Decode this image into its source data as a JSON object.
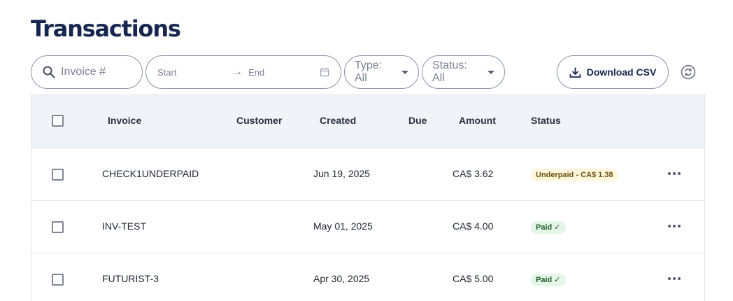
{
  "header": {
    "title": "Transactions"
  },
  "toolbar": {
    "search_placeholder": "Invoice #",
    "date_start_placeholder": "Start",
    "date_arrow": "→",
    "date_end_placeholder": "End",
    "type_filter_label": "Type: All",
    "status_filter_label": "Status: All",
    "download_label": "Download CSV",
    "icons": {
      "search": "search-icon",
      "calendar": "calendar-icon",
      "download": "download-icon",
      "refresh": "refresh-icon",
      "caret": "chevron-down-icon"
    }
  },
  "table": {
    "columns": [
      "Invoice",
      "Customer",
      "Created",
      "Due",
      "Amount",
      "Status"
    ],
    "rows": [
      {
        "invoice": "CHECK1UNDERPAID",
        "customer": "",
        "created": "Jun 19, 2025",
        "due": "",
        "amount": "CA$ 3.62",
        "status": "Underpaid - CA$ 1.38",
        "status_type": "underpaid"
      },
      {
        "invoice": "INV-TEST",
        "customer": "",
        "created": "May 01, 2025",
        "due": "",
        "amount": "CA$ 4.00",
        "status": "Paid ✓",
        "status_type": "paid"
      },
      {
        "invoice": "FUTURIST-3",
        "customer": "",
        "created": "Apr 30, 2025",
        "due": "",
        "amount": "CA$ 5.00",
        "status": "Paid ✓",
        "status_type": "paid"
      }
    ]
  },
  "colors": {
    "title": "#16264f",
    "header_bg": "#f0f3f8",
    "underpaid_badge_bg": "#fff6dc",
    "underpaid_badge_text": "#6c5314",
    "paid_badge_bg": "#e4f6e6",
    "paid_badge_text": "#1d5c2b"
  }
}
